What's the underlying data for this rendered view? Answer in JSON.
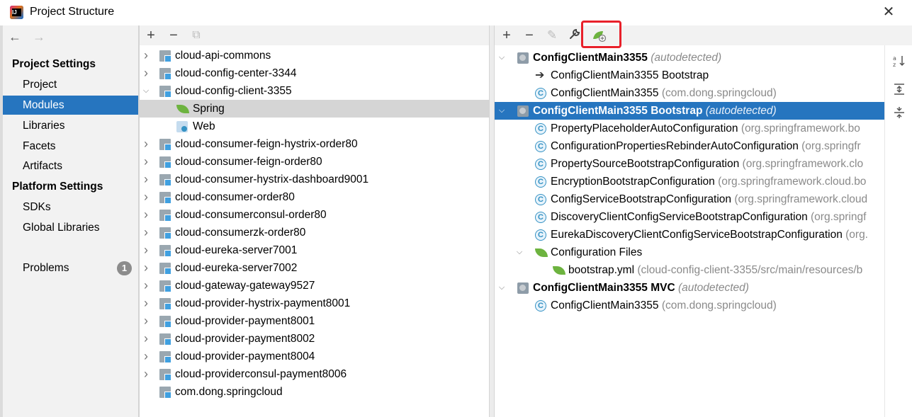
{
  "window": {
    "title": "Project Structure"
  },
  "nav": {
    "project_settings_header": "Project Settings",
    "platform_settings_header": "Platform Settings",
    "items": [
      "Project",
      "Modules",
      "Libraries",
      "Facets",
      "Artifacts",
      "SDKs",
      "Global Libraries",
      "Problems"
    ],
    "selected": "Modules",
    "problems_count": "1"
  },
  "modules": {
    "toolbar": {
      "add": "+",
      "remove": "−",
      "copy": "⧉"
    },
    "tree": [
      {
        "label": "cloud-api-commons",
        "icon": "module-folder-icon",
        "expanded": false
      },
      {
        "label": "cloud-config-center-3344",
        "icon": "module-folder-icon",
        "expanded": false
      },
      {
        "label": "cloud-config-client-3355",
        "icon": "module-folder-icon",
        "expanded": true
      },
      {
        "label": "Spring",
        "icon": "spring-leaf-icon",
        "child": true,
        "highlighted": true
      },
      {
        "label": "Web",
        "icon": "web-icon",
        "child": true
      },
      {
        "label": "cloud-consumer-feign-hystrix-order80",
        "icon": "module-folder-icon",
        "expanded": false
      },
      {
        "label": "cloud-consumer-feign-order80",
        "icon": "module-folder-icon",
        "expanded": false
      },
      {
        "label": "cloud-consumer-hystrix-dashboard9001",
        "icon": "module-folder-icon",
        "expanded": false
      },
      {
        "label": "cloud-consumer-order80",
        "icon": "module-folder-icon",
        "expanded": false
      },
      {
        "label": "cloud-consumerconsul-order80",
        "icon": "module-folder-icon",
        "expanded": false
      },
      {
        "label": "cloud-consumerzk-order80",
        "icon": "module-folder-icon",
        "expanded": false
      },
      {
        "label": "cloud-eureka-server7001",
        "icon": "module-folder-icon",
        "expanded": false
      },
      {
        "label": "cloud-eureka-server7002",
        "icon": "module-folder-icon",
        "expanded": false
      },
      {
        "label": "cloud-gateway-gateway9527",
        "icon": "module-folder-icon",
        "expanded": false
      },
      {
        "label": "cloud-provider-hystrix-payment8001",
        "icon": "module-folder-icon",
        "expanded": false
      },
      {
        "label": "cloud-provider-payment8001",
        "icon": "module-folder-icon",
        "expanded": false
      },
      {
        "label": "cloud-provider-payment8002",
        "icon": "module-folder-icon",
        "expanded": false
      },
      {
        "label": "cloud-provider-payment8004",
        "icon": "module-folder-icon",
        "expanded": false
      },
      {
        "label": "cloud-providerconsul-payment8006",
        "icon": "module-folder-icon",
        "expanded": false
      },
      {
        "label": "com.dong.springcloud",
        "icon": "module-folder-icon",
        "leaf": true
      }
    ]
  },
  "facet": {
    "toolbar": {
      "add": "+",
      "remove": "−",
      "edit": "✎",
      "settings": "🔧",
      "spring_add": "spring-add-icon"
    },
    "tree": [
      {
        "label": "ConfigClientMain3355",
        "suffix": "(autodetected)",
        "bold": true,
        "italic_suffix": true,
        "icon": "spring-context-icon",
        "expander": "open"
      },
      {
        "label": "ConfigClientMain3355 Bootstrap",
        "suffix": "",
        "icon": "arrow-right-icon"
      },
      {
        "label": "ConfigClientMain3355",
        "suffix": "(com.dong.springcloud)",
        "icon": "spring-class-icon"
      },
      {
        "label": "ConfigClientMain3355 Bootstrap",
        "suffix": "(autodetected)",
        "bold": true,
        "italic_suffix": true,
        "selected": true,
        "icon": "spring-context-icon",
        "expander": "open"
      },
      {
        "label": "PropertyPlaceholderAutoConfiguration",
        "suffix": "(org.springframework.bo",
        "icon": "spring-class-icon"
      },
      {
        "label": "ConfigurationPropertiesRebinderAutoConfiguration",
        "suffix": "(org.springfr",
        "icon": "spring-class-icon"
      },
      {
        "label": "PropertySourceBootstrapConfiguration",
        "suffix": "(org.springframework.clo",
        "icon": "spring-class-icon"
      },
      {
        "label": "EncryptionBootstrapConfiguration",
        "suffix": "(org.springframework.cloud.bo",
        "icon": "spring-class-icon"
      },
      {
        "label": "ConfigServiceBootstrapConfiguration",
        "suffix": "(org.springframework.cloud",
        "icon": "spring-class-icon"
      },
      {
        "label": "DiscoveryClientConfigServiceBootstrapConfiguration",
        "suffix": "(org.springf",
        "icon": "spring-class-icon"
      },
      {
        "label": "EurekaDiscoveryClientConfigServiceBootstrapConfiguration",
        "suffix": "(org.",
        "icon": "spring-class-icon"
      },
      {
        "label": "Configuration Files",
        "suffix": "",
        "icon": "spring-leaf-icon",
        "expander": "open"
      },
      {
        "label": "bootstrap.yml",
        "suffix": "(cloud-config-client-3355/src/main/resources/b",
        "icon": "spring-leaf-icon"
      },
      {
        "label": "ConfigClientMain3355 MVC",
        "suffix": "(autodetected)",
        "bold": true,
        "italic_suffix": true,
        "icon": "spring-context-icon",
        "expander": "open"
      },
      {
        "label": "ConfigClientMain3355",
        "suffix": "(com.dong.springcloud)",
        "icon": "spring-class-icon"
      }
    ],
    "side_buttons": [
      "sort-alpha-icon",
      "expand-all-icon",
      "collapse-all-icon"
    ]
  }
}
